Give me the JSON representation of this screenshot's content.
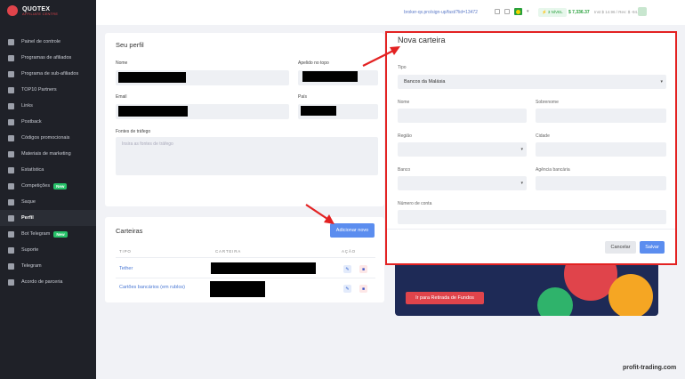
{
  "brand": {
    "name": "QUOTEX",
    "subtitle": "AFFILIATE CENTRE"
  },
  "sidebar": {
    "items": [
      {
        "label": "Painel de controle",
        "icon": "grid-icon"
      },
      {
        "label": "Programas de afiliados",
        "icon": "folder-icon"
      },
      {
        "label": "Programa de sub-afiliados",
        "icon": "paper-plane-icon"
      },
      {
        "label": "TOP10 Partners",
        "icon": "trend-icon"
      },
      {
        "label": "Links",
        "icon": "link-icon"
      },
      {
        "label": "Postback",
        "icon": "postback-icon"
      },
      {
        "label": "Códigos promocionais",
        "icon": "promo-code-icon"
      },
      {
        "label": "Materiais de marketing",
        "icon": "marketing-icon"
      },
      {
        "label": "Estatística",
        "icon": "pie-chart-icon"
      },
      {
        "label": "Competições",
        "icon": "trophy-icon",
        "badge": "New"
      },
      {
        "label": "Saque",
        "icon": "wallet-icon"
      },
      {
        "label": "Perfil",
        "icon": "user-icon",
        "active": true
      },
      {
        "label": "Bot Telegram",
        "icon": "bot-icon",
        "badge": "New"
      },
      {
        "label": "Suporte",
        "icon": "support-icon"
      },
      {
        "label": "Telegram",
        "icon": "telegram-icon"
      },
      {
        "label": "Acordo de parceria",
        "icon": "document-icon"
      }
    ]
  },
  "topbar": {
    "url": "broker-qx.pro/sign-up/fast/?lid=13472",
    "level": "⚡ 3 NÍVEL",
    "balance": "$ 7,336.37",
    "sub_balance": "Inst $ 14.96 / Rev: $ -94.76"
  },
  "profile": {
    "title": "Seu perfil",
    "name_label": "Nome",
    "nickname_label": "Apelido no topo",
    "email_label": "Email",
    "country_label": "País",
    "traffic_label": "Fontes de tráfego",
    "traffic_placeholder": "Insira as fontes de tráfego"
  },
  "wallets": {
    "title": "Carteiras",
    "add_button": "Adicionar novo",
    "columns": [
      "TIPO",
      "CARTEIRA",
      "AÇÃO"
    ],
    "rows": [
      {
        "type": "Tether"
      },
      {
        "type": "Cartões bancários (em rublos)"
      }
    ]
  },
  "withdraw_button": "Ir para Retirada de Fundos",
  "modal": {
    "title": "Nova carteira",
    "type_label": "Tipo",
    "type_value": "Bancos da Malásia",
    "name_label": "Nome",
    "surname_label": "Sobrenome",
    "region_label": "Região",
    "city_label": "Cidade",
    "bank_label": "Banco",
    "branch_label": "Agência bancária",
    "account_label": "Número de conta",
    "cancel": "Cancelar",
    "save": "Salvar"
  },
  "watermark": "profit-trading.com",
  "colors": {
    "accent": "#5b8def",
    "brand_red": "#e0444b",
    "highlight": "#e32222",
    "success": "#27a03b"
  }
}
